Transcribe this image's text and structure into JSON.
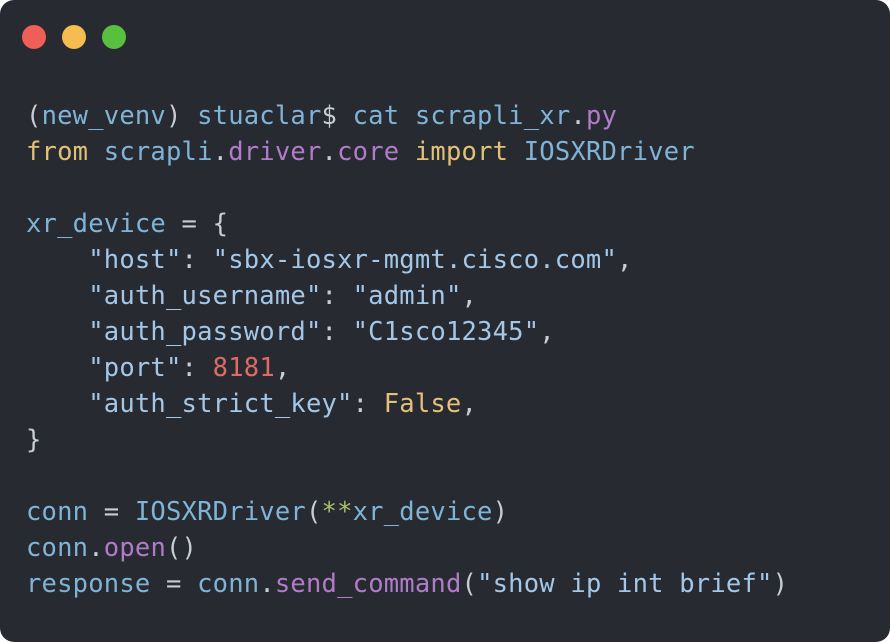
{
  "window": {
    "background": "#272b31",
    "controls": [
      {
        "name": "close-button",
        "color": "#ee5f57"
      },
      {
        "name": "minimize-button",
        "color": "#f5bc4f"
      },
      {
        "name": "zoom-button",
        "color": "#58c03f"
      }
    ]
  },
  "colors": {
    "plain": "#c8ccd4",
    "identifier": "#7fb4d6",
    "keyword": "#e1c176",
    "module": "#b07cc9",
    "string": "#a4c7e8",
    "number": "#dd6b66",
    "constant": "#e5c07b",
    "operator": "#a7c26b"
  },
  "code": {
    "lines": [
      [
        {
          "t": "(",
          "c": "plain"
        },
        {
          "t": "new_venv",
          "c": "identifier"
        },
        {
          "t": ") ",
          "c": "plain"
        },
        {
          "t": "stuaclar",
          "c": "identifier"
        },
        {
          "t": "$ ",
          "c": "plain"
        },
        {
          "t": "cat ",
          "c": "identifier"
        },
        {
          "t": "scrapli_xr",
          "c": "identifier"
        },
        {
          "t": ".",
          "c": "plain"
        },
        {
          "t": "py",
          "c": "module"
        }
      ],
      [
        {
          "t": "from ",
          "c": "keyword"
        },
        {
          "t": "scrapli",
          "c": "identifier"
        },
        {
          "t": ".",
          "c": "plain"
        },
        {
          "t": "driver",
          "c": "module"
        },
        {
          "t": ".",
          "c": "plain"
        },
        {
          "t": "core ",
          "c": "module"
        },
        {
          "t": "import ",
          "c": "keyword"
        },
        {
          "t": "IOSXRDriver",
          "c": "identifier"
        }
      ],
      [],
      [
        {
          "t": "xr_device ",
          "c": "identifier"
        },
        {
          "t": "= ",
          "c": "plain"
        },
        {
          "t": "{",
          "c": "plain"
        }
      ],
      [
        {
          "t": "    ",
          "c": "plain"
        },
        {
          "t": "\"host\"",
          "c": "string"
        },
        {
          "t": ": ",
          "c": "plain"
        },
        {
          "t": "\"sbx-iosxr-mgmt.cisco.com\"",
          "c": "string"
        },
        {
          "t": ",",
          "c": "plain"
        }
      ],
      [
        {
          "t": "    ",
          "c": "plain"
        },
        {
          "t": "\"auth_username\"",
          "c": "string"
        },
        {
          "t": ": ",
          "c": "plain"
        },
        {
          "t": "\"admin\"",
          "c": "string"
        },
        {
          "t": ",",
          "c": "plain"
        }
      ],
      [
        {
          "t": "    ",
          "c": "plain"
        },
        {
          "t": "\"auth_password\"",
          "c": "string"
        },
        {
          "t": ": ",
          "c": "plain"
        },
        {
          "t": "\"C1sco12345\"",
          "c": "string"
        },
        {
          "t": ",",
          "c": "plain"
        }
      ],
      [
        {
          "t": "    ",
          "c": "plain"
        },
        {
          "t": "\"port\"",
          "c": "string"
        },
        {
          "t": ": ",
          "c": "plain"
        },
        {
          "t": "8181",
          "c": "number"
        },
        {
          "t": ",",
          "c": "plain"
        }
      ],
      [
        {
          "t": "    ",
          "c": "plain"
        },
        {
          "t": "\"auth_strict_key\"",
          "c": "string"
        },
        {
          "t": ": ",
          "c": "plain"
        },
        {
          "t": "False",
          "c": "constant"
        },
        {
          "t": ",",
          "c": "plain"
        }
      ],
      [
        {
          "t": "}",
          "c": "plain"
        }
      ],
      [],
      [
        {
          "t": "conn ",
          "c": "identifier"
        },
        {
          "t": "= ",
          "c": "plain"
        },
        {
          "t": "IOSXRDriver",
          "c": "identifier"
        },
        {
          "t": "(",
          "c": "plain"
        },
        {
          "t": "**",
          "c": "operator"
        },
        {
          "t": "xr_device",
          "c": "identifier"
        },
        {
          "t": ")",
          "c": "plain"
        }
      ],
      [
        {
          "t": "conn",
          "c": "identifier"
        },
        {
          "t": ".",
          "c": "plain"
        },
        {
          "t": "open",
          "c": "module"
        },
        {
          "t": "()",
          "c": "plain"
        }
      ],
      [
        {
          "t": "response ",
          "c": "identifier"
        },
        {
          "t": "= ",
          "c": "plain"
        },
        {
          "t": "conn",
          "c": "identifier"
        },
        {
          "t": ".",
          "c": "plain"
        },
        {
          "t": "send_command",
          "c": "module"
        },
        {
          "t": "(",
          "c": "plain"
        },
        {
          "t": "\"show ip int brief\"",
          "c": "string"
        },
        {
          "t": ")",
          "c": "plain"
        }
      ]
    ]
  }
}
